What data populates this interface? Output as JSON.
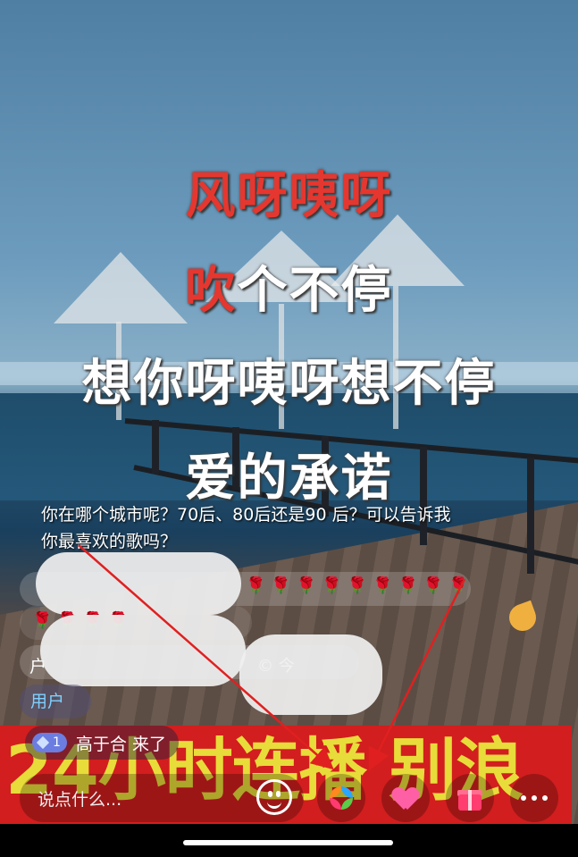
{
  "lyrics": {
    "line1_red": "风呀咦呀",
    "line2_red": "吹",
    "line2_rest": "个不停",
    "line3": "想你呀咦呀想不停",
    "line4": "爱的承诺"
  },
  "comments": {
    "question": "你在哪个城市呢？70后、80后还是90 后？可以告诉我你最喜欢的歌吗？",
    "roses_row1": "🌹🌹🌹🌹🌹🌹🌹🌹🌹",
    "roses_row2": "🌹🌹🌹🌹",
    "user_prefix": "用户",
    "row3_char": "户",
    "row3_extra": "© 今"
  },
  "join": {
    "level": "1",
    "username": "高于合",
    "action": "来了"
  },
  "banner_text": "24小时连播 别浪",
  "bottom_bar": {
    "input_placeholder": "说点什么..."
  },
  "icons": [
    "smile-icon",
    "pinwheel-icon",
    "heart-planet-icon",
    "gift-icon",
    "more-icon"
  ],
  "colors": {
    "lyric_red": "#e5372f",
    "banner_bg": "#d21e1e",
    "banner_text": "#e8dc3a",
    "arrow": "#e02020"
  }
}
